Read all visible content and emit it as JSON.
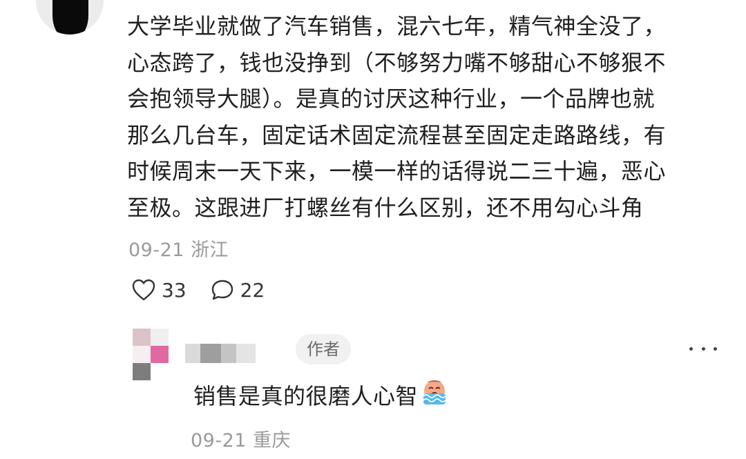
{
  "comment": {
    "lines": [
      "大学毕业就做了汽车销售，混六七年，精气神全没了，",
      "心态跨了，钱也没挣到（不够努力嘴不够甜心不够狠不",
      "会抱领导大腿）。是真的讨厌这种行业，一个品牌也就",
      "那么几台车，固定话术固定流程甚至固定走路路线，有",
      "时候周末一天下来，一模一样的话得说二三十遍，恶心",
      "至极。这跟进厂打螺丝有什么区别，还不用勾心斗角"
    ],
    "date": "09-21",
    "location": "浙江",
    "likes": "33",
    "replies": "22"
  },
  "reply": {
    "badge": "作者",
    "text": "销售是真的很磨人心智",
    "emoji": "crying-face-icon",
    "date": "09-21",
    "location": "重庆"
  }
}
